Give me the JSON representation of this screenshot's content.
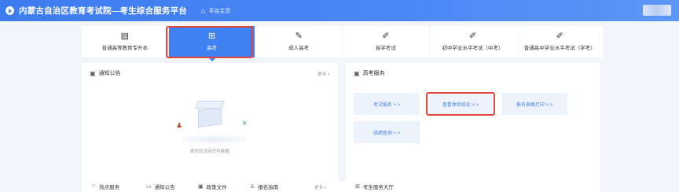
{
  "header": {
    "title": "内蒙古自治区教育考试院—考生综合服务平台",
    "home_label": "平台主页"
  },
  "tabs": [
    {
      "label": "普通高等教育专升本",
      "icon": "document-icon"
    },
    {
      "label": "高考",
      "icon": "book-icon",
      "active": true
    },
    {
      "label": "成人高考",
      "icon": "pen-icon"
    },
    {
      "label": "自学考试",
      "icon": "edit-icon"
    },
    {
      "label": "初中学业水平考试（中考）",
      "icon": "edit-icon"
    },
    {
      "label": "普通高中学业水平考试（学考）",
      "icon": "edit-icon"
    }
  ],
  "notice": {
    "title": "通知公告",
    "more": "更多 >",
    "empty_text": "暂时还没有任何数据"
  },
  "gaokao_service": {
    "title": "高考服务",
    "buttons": [
      "考试报名 > >",
      "查看体检结论 > >",
      "报名表格打印 > >",
      "成绩查询 > >"
    ]
  },
  "bottom": {
    "items": [
      "热点服务",
      "通知公告",
      "政策文件",
      "报名指南"
    ],
    "more": "更多 >",
    "hall_title": "考生服务大厅"
  },
  "colors": {
    "primary": "#3f80f2",
    "highlight": "#e0463c"
  }
}
